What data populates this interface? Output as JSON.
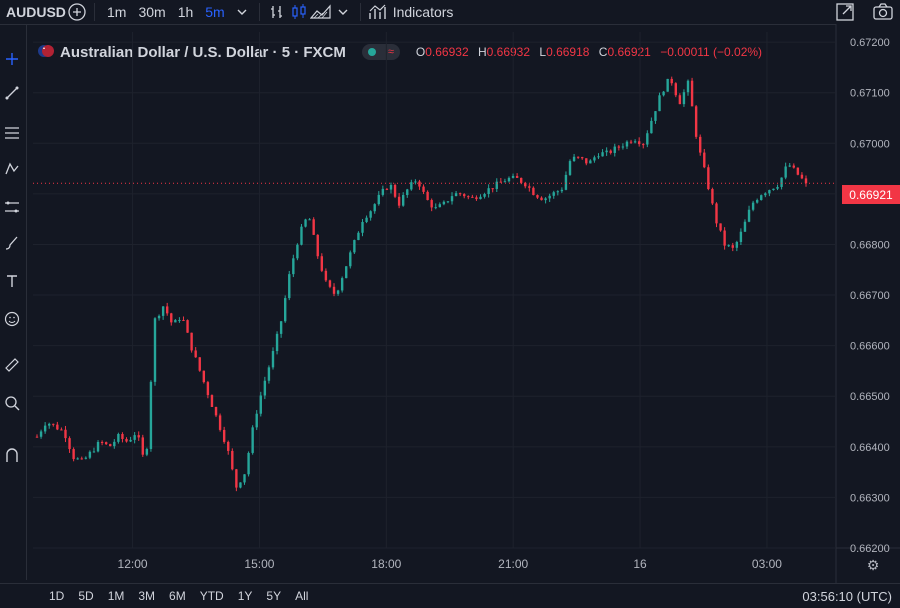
{
  "topbar": {
    "symbol": "AUDUSD",
    "intervals": [
      "1m",
      "30m",
      "1h",
      "5m"
    ],
    "active_interval": "5m",
    "indicators_label": "Indicators"
  },
  "legend": {
    "title": "Australian Dollar / U.S. Dollar · 5 · FXCM",
    "o_label": "O",
    "o_value": "0.66932",
    "h_label": "H",
    "h_value": "0.66932",
    "l_label": "L",
    "l_value": "0.66918",
    "c_label": "C",
    "c_value": "0.66921",
    "change": "−0.00011 (−0.02%)"
  },
  "price_tag": "0.66921",
  "bottombar": {
    "ranges": [
      "1D",
      "5D",
      "1M",
      "3M",
      "6M",
      "YTD",
      "1Y",
      "5Y",
      "All"
    ],
    "clock": "03:56:10 (UTC)"
  },
  "colors": {
    "up": "#26a69a",
    "down": "#f23645",
    "bg": "#131722",
    "grid": "#1e222d",
    "accent": "#2962ff"
  },
  "chart_data": {
    "type": "candlestick",
    "series_name": "AUDUSD",
    "y_ticks": [
      "0.67200",
      "0.67100",
      "0.67000",
      "0.66900",
      "0.66800",
      "0.66700",
      "0.66600",
      "0.66500",
      "0.66400",
      "0.66300",
      "0.66200"
    ],
    "x_ticks": [
      "12:00",
      "15:00",
      "18:00",
      "21:00",
      "16",
      "03:00"
    ],
    "ylim": [
      0.662,
      0.6722
    ],
    "last_price": 0.66921,
    "path": [
      0.6642,
      0.6645,
      0.6644,
      0.6643,
      0.6638,
      0.6637,
      0.6639,
      0.6641,
      0.664,
      0.6642,
      0.6641,
      0.6643,
      0.6636,
      0.6665,
      0.6668,
      0.6664,
      0.6666,
      0.666,
      0.6655,
      0.665,
      0.6645,
      0.664,
      0.6632,
      0.6635,
      0.6645,
      0.6652,
      0.6658,
      0.6665,
      0.6675,
      0.6682,
      0.6686,
      0.6678,
      0.6672,
      0.667,
      0.6675,
      0.668,
      0.6685,
      0.6687,
      0.669,
      0.6692,
      0.6688,
      0.6691,
      0.6693,
      0.6689,
      0.6687,
      0.6688,
      0.669,
      0.669,
      0.6689,
      0.669,
      0.6691,
      0.6692,
      0.6693,
      0.6693,
      0.6692,
      0.669,
      0.6689,
      0.669,
      0.6691,
      0.6697,
      0.6697,
      0.6696,
      0.6698,
      0.6698,
      0.6699,
      0.67,
      0.6701,
      0.67,
      0.6705,
      0.671,
      0.6713,
      0.6708,
      0.6712,
      0.67,
      0.6693,
      0.6685,
      0.668,
      0.6679,
      0.6683,
      0.6688,
      0.669,
      0.6691,
      0.6692,
      0.6696,
      0.6694,
      0.6692
    ]
  }
}
